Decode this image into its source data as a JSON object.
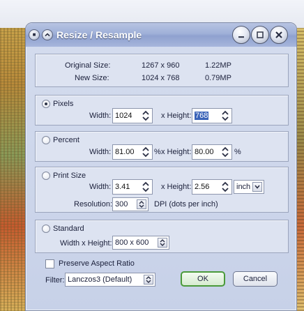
{
  "window": {
    "title": "Resize / Resample"
  },
  "info": {
    "original_label": "Original Size:",
    "original_dims": "1267 x 960",
    "original_mp": "1.22MP",
    "new_label": "New Size:",
    "new_dims": "1024 x 768",
    "new_mp": "0.79MP"
  },
  "pixels": {
    "label": "Pixels",
    "selected": true,
    "width_label": "Width:",
    "width_value": "1024",
    "height_label": "x Height:",
    "height_value": "768"
  },
  "percent": {
    "label": "Percent",
    "width_label": "Width:",
    "width_value": "81.00",
    "width_unit": "%",
    "height_label": "x Height:",
    "height_value": "80.00",
    "height_unit": "%"
  },
  "print_size": {
    "label": "Print Size",
    "width_label": "Width:",
    "width_value": "3.41",
    "height_label": "x Height:",
    "height_value": "2.56",
    "unit_value": "inch",
    "resolution_label": "Resolution:",
    "resolution_value": "300",
    "resolution_unit": "DPI (dots per inch)"
  },
  "standard": {
    "label": "Standard",
    "size_label": "Width x Height:",
    "size_value": "800 x 600"
  },
  "options": {
    "preserve_label": "Preserve Aspect Ratio",
    "preserve_checked": false,
    "filter_label": "Filter:",
    "filter_value": "Lanczos3 (Default)"
  },
  "buttons": {
    "ok": "OK",
    "cancel": "Cancel"
  },
  "colors": {
    "title_gradient_top": "#b8c4e2",
    "ok_border": "#4a9a3a",
    "selection_blue": "#3a63b8"
  }
}
